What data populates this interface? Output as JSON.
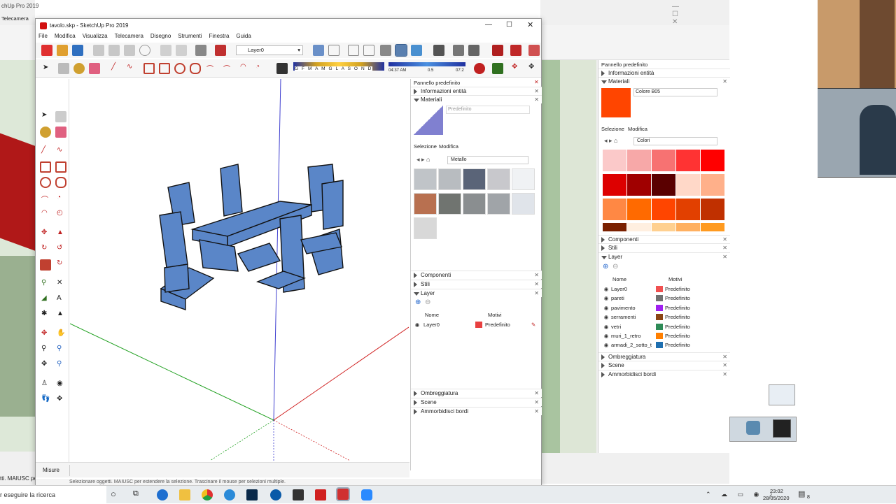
{
  "bg_window": {
    "title": "chUp Pro 2019",
    "menu_fragment": "Telecamera",
    "status_fragment": "tti. MAIUSC per"
  },
  "main_window": {
    "title": "tavolo.skp - SketchUp Pro 2019",
    "menu": [
      "File",
      "Modifica",
      "Visualizza",
      "Telecamera",
      "Disegno",
      "Strumenti",
      "Finestra",
      "Guida"
    ],
    "layer_dropdown": "Layer0",
    "shadow_letters": "G F M A M G L A S O N D",
    "shadow_time_start": "04:37 AM",
    "shadow_mid": "0.5",
    "shadow_time_end": "07:2",
    "measure_label": "Misure",
    "status_text": "Selezionare oggetti. MAIUSC per estendere la selezione. Trascinare il mouse per selezioni multiple."
  },
  "inner_tray": {
    "title": "Pannello predefinito",
    "entity_info": "Informazioni entità",
    "materials": "Materiali",
    "material_name": "Predefinito",
    "tab_select": "Selezione",
    "tab_edit": "Modifica",
    "library": "Metallo",
    "components": "Componenti",
    "styles": "Stili",
    "layer": "Layer",
    "col_name": "Nome",
    "col_pattern": "Motivi",
    "layers": [
      {
        "name": "Layer0",
        "color": "#e84040",
        "style": "Predefinito"
      }
    ],
    "shadows": "Ombreggiatura",
    "scenes": "Scene",
    "soften": "Ammorbidisci bordi"
  },
  "outer_tray": {
    "title": "Pannello predefinito",
    "entity_info": "Informazioni entità",
    "materials": "Materiali",
    "material_name": "Colore B05",
    "material_color": "#ff4500",
    "tab_select": "Selezione",
    "tab_edit": "Modifica",
    "library": "Colori",
    "components": "Componenti",
    "styles": "Stili",
    "layer": "Layer",
    "col_name": "Nome",
    "col_pattern": "Motivi",
    "layers": [
      {
        "name": "Layer0",
        "color": "#f05050",
        "style": "Predefinito"
      },
      {
        "name": "pareti",
        "color": "#707070",
        "style": "Predefinito"
      },
      {
        "name": "pavimento",
        "color": "#a020f0",
        "style": "Predefinito"
      },
      {
        "name": "serramenti",
        "color": "#8b4513",
        "style": "Predefinito"
      },
      {
        "name": "vetri",
        "color": "#2e8b57",
        "style": "Predefinito"
      },
      {
        "name": "muri_1_retro",
        "color": "#ff7f00",
        "style": "Predefinito"
      },
      {
        "name": "armadi_2_sotto_t",
        "color": "#1e6fb0",
        "style": "Predefinito"
      }
    ],
    "shadows": "Ombreggiatura",
    "scenes": "Scene",
    "soften": "Ammorbidisci bordi"
  },
  "colors": {
    "swatches": [
      "#fbc9c9",
      "#f7a8a8",
      "#f77272",
      "#ff3333",
      "#ff0000",
      "#dd0000",
      "#a00000",
      "#5a0000",
      "#ffd8c8",
      "#ffb08a",
      "#ff8844",
      "#ff6a00",
      "#ff4500",
      "#e24000",
      "#c03000",
      "#7a2000",
      "#ffefe0",
      "#ffd090",
      "#ffb060",
      "#ff9a20"
    ],
    "metals": [
      "#c0c4c8",
      "#b8bcc0",
      "#5a6478",
      "#c8c8cc",
      "#f0f2f4",
      "#b87050",
      "#707470",
      "#8a8e90",
      "#a0a4a8",
      "#e0e4ea",
      "#d8d8d8"
    ]
  },
  "taskbar": {
    "search": "r eseguire la ricerca",
    "time": "23:02",
    "date": "28/05/2020",
    "notif": "8"
  }
}
